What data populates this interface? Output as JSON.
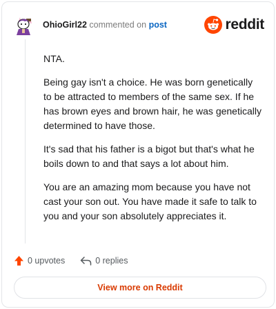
{
  "comment": {
    "author": "OhioGirl22",
    "verb": "commented on",
    "post_link": "post",
    "paragraphs": [
      "NTA.",
      "Being gay isn't a choice. He was born genetically to be attracted to members of the same sex. If he has brown eyes and brown hair, he was genetically determined to have those.",
      "It's sad that his father is a bigot but that's what he boils down to and that says a lot about him.",
      "You are an amazing mom because you have not cast your son out. You have made it safe to talk to you and your son absolutely appreciates it."
    ]
  },
  "brand": {
    "wordmark": "reddit",
    "color": "#ff4500"
  },
  "actions": {
    "upvotes_label": "0 upvotes",
    "replies_label": "0 replies",
    "upvote_color": "#ff4500"
  },
  "footer": {
    "view_more_label": "View more on Reddit",
    "link_color": "#d93a00"
  }
}
